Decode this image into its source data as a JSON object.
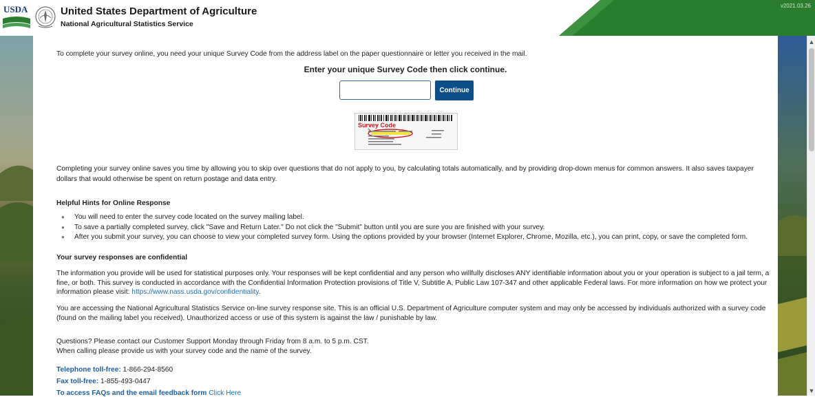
{
  "header": {
    "logo_text": "USDA",
    "title": "United States Department of Agriculture",
    "subtitle": "National Agricultural Statistics Service",
    "version": "v2021.03.26",
    "logo_icon": "usda-logo",
    "seal_icon": "nass-seal-icon",
    "brand_color": "#2a7d2e"
  },
  "main": {
    "intro": "To complete your survey online, you need your unique Survey Code from the address label on the paper questionnaire or letter you received in the mail.",
    "instruction": "Enter your unique Survey Code then click continue.",
    "code_input_value": "",
    "code_input_placeholder": "",
    "continue_label": "Continue",
    "label_image_caption": "Survey Code",
    "benefits": "Completing your survey online saves you time by allowing you to skip over questions that do not apply to you, by calculating totals automatically, and by providing drop-down menus for common answers. It also saves taxpayer dollars that would otherwise be spent on return postage and data entry."
  },
  "hints": {
    "title": "Helpful Hints for Online Response",
    "items": [
      "You will need to enter the survey code located on the survey mailing label.",
      "To save a partially completed survey, click \"Save and Return Later.\" Do not click the \"Submit\" button until you are sure you are finished with your survey.",
      "After you submit your survey, you can choose to view your completed survey form. Using the options provided by your browser (Internet Explorer, Chrome, Mozilla, etc.), you can print, copy, or save the completed form."
    ]
  },
  "confidential": {
    "title": "Your survey responses are confidential",
    "text": "The information you provide will be used for statistical purposes only. Your responses will be kept confidential and any person who willfully discloses ANY identifiable information about you or your operation is subject to a jail term, a fine, or both. This survey is conducted in accordance with the Confidential Information Protection provisions of Title V, Subtitle A, Public Law 107-347 and other applicable Federal laws. For more information on how we protect your information please visit:",
    "link": "https://www.nass.usda.gov/confidentiality",
    "link_suffix": ".",
    "access": "You are accessing the National Agricultural Statistics Service on-line survey response site. This is an official U.S. Department of Agriculture computer system and may only be accessed by individuals authorized with a survey code (found on the mailing label you received). Unauthorized access or use of this system is against the law / punishable by law."
  },
  "contact": {
    "line1": "Questions? Please contact our Customer Support Monday through Friday from 8 a.m. to 5 p.m. CST.",
    "line2": "When calling please provide us with your survey code and the name of the survey.",
    "phone_label": "Telephone toll-free:",
    "phone": "1-866-294-8560",
    "fax_label": "Fax toll-free:",
    "fax": "1-855-493-0447",
    "faq_label": "To access FAQs and the email feedback form",
    "faq_link": "Click Here"
  }
}
